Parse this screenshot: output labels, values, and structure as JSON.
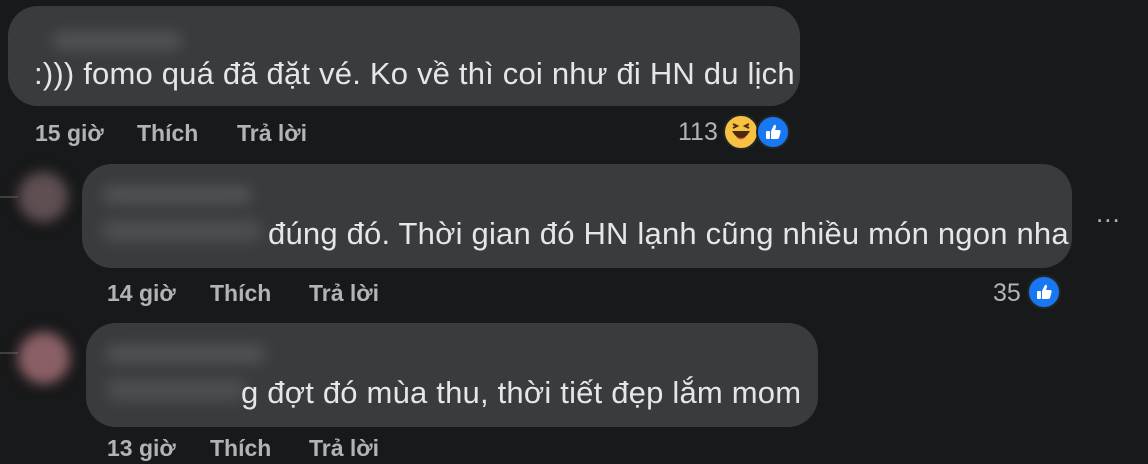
{
  "comments": [
    {
      "text": ":))) fomo quá đã đặt vé. Ko về thì coi như đi HN du lịch",
      "time": "15 giờ",
      "like_label": "Thích",
      "reply_label": "Trả lời",
      "reaction_count": "113",
      "reactions": [
        "haha-icon",
        "like-icon"
      ]
    },
    {
      "text": "đúng đó. Thời gian đó HN lạnh cũng nhiều món ngon nha",
      "time": "14 giờ",
      "like_label": "Thích",
      "reply_label": "Trả lời",
      "reaction_count": "35",
      "reactions": [
        "like-icon"
      ]
    },
    {
      "text": "g đợt đó mùa thu, thời tiết đẹp lắm mom",
      "time": "13 giờ",
      "like_label": "Thích",
      "reply_label": "Trả lời"
    }
  ],
  "more_menu_label": "...",
  "colors": {
    "background": "#18191a",
    "bubble": "#3a3b3c",
    "text": "#e4e6eb",
    "secondary_text": "#b0b3b8",
    "like_blue": "#1877f2",
    "haha_yellow": "#f7c144"
  }
}
